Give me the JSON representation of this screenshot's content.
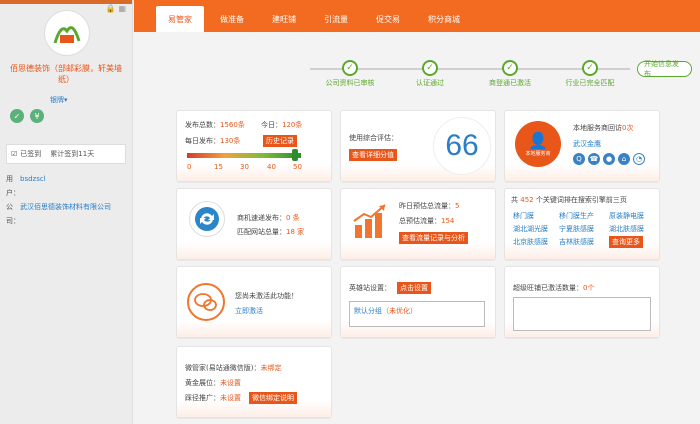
{
  "sidebar": {
    "shop_name": "佰思德装饰（部邮彩膜，轩美墙纸）",
    "vip_label": "银牌▾",
    "checkin_status": "已签到",
    "checkin_days": "累计签到11天",
    "user_label": "用户：",
    "user_value": "bsdzscl",
    "company_label": "公司：",
    "company_value": "武汉佰思德装饰材料有限公司",
    "badge_1": "✓",
    "badge_2": "¥"
  },
  "nav": {
    "tabs": [
      "易管家",
      "做准备",
      "建旺铺",
      "引流量",
      "促交易",
      "积分商城"
    ]
  },
  "progress": {
    "steps": [
      "公司资料已审核",
      "认证通过",
      "商登通已激活",
      "行业已完全匹配"
    ],
    "final": "开始信息发布"
  },
  "stats": {
    "total_label": "发布总数：",
    "total_value": "1560条",
    "today_label": "今日：",
    "today_value": "120条",
    "daily_label": "每日发布：",
    "daily_value": "130条",
    "history_btn": "历史记录",
    "scale_ticks": [
      "0",
      "15",
      "30",
      "40",
      "50"
    ],
    "daily_fraction": 0.95
  },
  "score": {
    "label": "使用综合评估：",
    "btn": "查看详细分值",
    "value": "66"
  },
  "service": {
    "label": "本地服务商回访",
    "count": "0次",
    "avatar_label": "本地服务商",
    "company": "武汉金鹰"
  },
  "mobile": {
    "label1": "商机速递发布：",
    "value1": "0 条",
    "label2": "匹配网站总量：",
    "value2": "18 家"
  },
  "traffic": {
    "label1": "昨日预估总流量：",
    "value1": "5",
    "label2": "总预估流量：",
    "value2": "154",
    "btn": "查看流量记录与分析"
  },
  "keywords": {
    "prefix": "共",
    "count": "452",
    "suffix": "个关键词排在搜索引擎前三页",
    "items": [
      "移门膜",
      "移门膜生产",
      "原装静电膜",
      "湖北湖光膜",
      "宁夏肤感膜",
      "湖北肤感膜",
      "北京肤感膜",
      "吉林肤感膜"
    ],
    "btn": "查询更多"
  },
  "wechat": {
    "label": "您尚未激活此功能！",
    "link": "立即激活"
  },
  "settings": {
    "label": "英雄站设置：",
    "btn": "点击设置",
    "option": "默认分组",
    "option_suffix": "（未优化）"
  },
  "winprice": {
    "label": "超级旺铺已激活数量：",
    "value": "0个"
  },
  "bottom": {
    "row1_label": "微管家(易站通微信版)：",
    "row1_value": "未绑定",
    "row2_label": "黄金展位：",
    "row2_value": "未设置",
    "row3_label": "踩径推广：",
    "row3_value": "未设置",
    "row3_btn": "微信绑定说明"
  },
  "colors": {
    "accent": "#f26b21",
    "green": "#5aa82d",
    "link": "#2a7ec8"
  }
}
